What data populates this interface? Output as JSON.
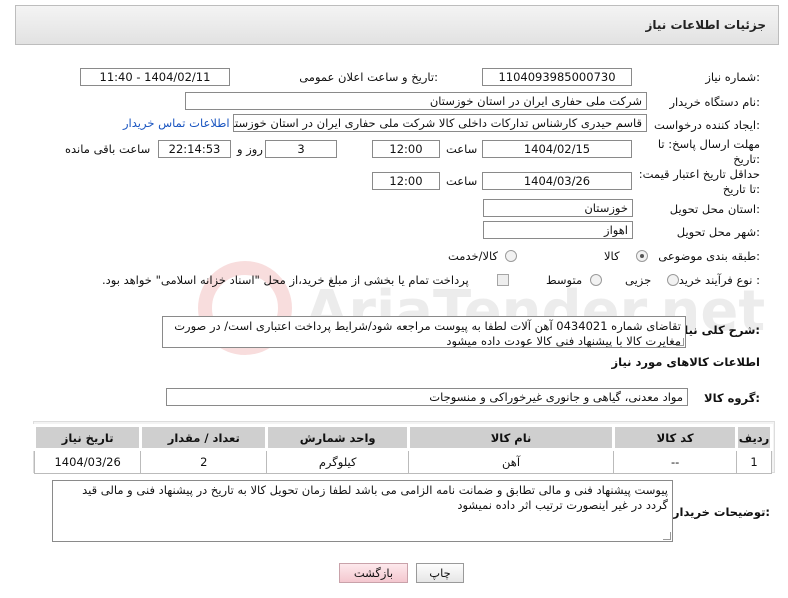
{
  "header": {
    "title": "جزئیات اطلاعات نیاز"
  },
  "need_number": {
    "label": "شماره نیاز:",
    "value": "1104093985000730"
  },
  "announce_datetime": {
    "label": "تاریخ و ساعت اعلان عمومی:",
    "value": "1404/02/11 - 11:40"
  },
  "buyer_org": {
    "label": "نام دستگاه خریدار:",
    "value": "شرکت ملی حفاری ایران در استان خوزستان"
  },
  "requester": {
    "label": "ایجاد کننده درخواست:",
    "value": "قاسم حیدری کارشناس تدارکات داخلی کالا شرکت ملی حفاری ایران در استان خوزستان",
    "contact_link": "اطلاعات تماس خریدار"
  },
  "reply_deadline": {
    "label": "مهلت ارسال پاسخ: تا تاریخ:",
    "date": "1404/02/15",
    "time_label": "ساعت",
    "time": "12:00",
    "days": "3",
    "days_label": "روز و",
    "remaining": "22:14:53",
    "remaining_label": "ساعت باقی مانده"
  },
  "price_validity": {
    "label": "حداقل تاریخ اعتبار قیمت: تا تاریخ:",
    "date": "1404/03/26",
    "time_label": "ساعت",
    "time": "12:00"
  },
  "delivery_province": {
    "label": "استان محل تحویل:",
    "value": "خوزستان"
  },
  "delivery_city": {
    "label": "شهر محل تحویل:",
    "value": "اهواز"
  },
  "category": {
    "label": "طبقه بندی موضوعی:",
    "options": [
      "کالا",
      "کالا/خدمت"
    ],
    "selected": "کالا"
  },
  "purchase_process": {
    "label": "نوع فرآیند خرید :",
    "options": [
      "جزیی",
      "متوسط"
    ],
    "selected": "جزیی",
    "payment_note": "پرداخت تمام یا بخشی از مبلغ خرید،از محل \"اسناد خزانه اسلامی\" خواهد بود."
  },
  "description": {
    "label": "شرح کلی نیاز:",
    "line1": "تقاضای شماره 0434021 آهن آلات لطفا به پیوست مراجعه شود/شرایط پرداخت اعتباری است/ در صورت",
    "line2": "مغایرت کالا با پیشنهاد فنی کالا عودت داده میشود"
  },
  "items_section": {
    "title": "اطلاعات کالاهای مورد نیاز"
  },
  "goods_group": {
    "label": "گروه کالا:",
    "value": "مواد معدنی، گیاهی و جانوری غیرخوراکی و منسوجات"
  },
  "items_table": {
    "headers": [
      "ردیف",
      "کد کالا",
      "نام کالا",
      "واحد شمارش",
      "تعداد / مقدار",
      "تاریخ نیاز"
    ],
    "rows": [
      [
        "1",
        "--",
        "آهن",
        "کیلوگرم",
        "2",
        "1404/03/26"
      ]
    ]
  },
  "buyer_notes": {
    "label": "توضیحات خریدار:",
    "line1": "پیوست پیشنهاد فنی و مالی تطابق و ضمانت نامه الزامی می باشد لطفا زمان تحویل کالا به تاریخ در پیشنهاد فنی و مالی قید",
    "line2": "گردد در غیر اینصورت ترتیب اثر داده نمیشود"
  },
  "buttons": {
    "print": "چاپ",
    "back": "بازگشت"
  },
  "watermark": "AriaTender.net"
}
